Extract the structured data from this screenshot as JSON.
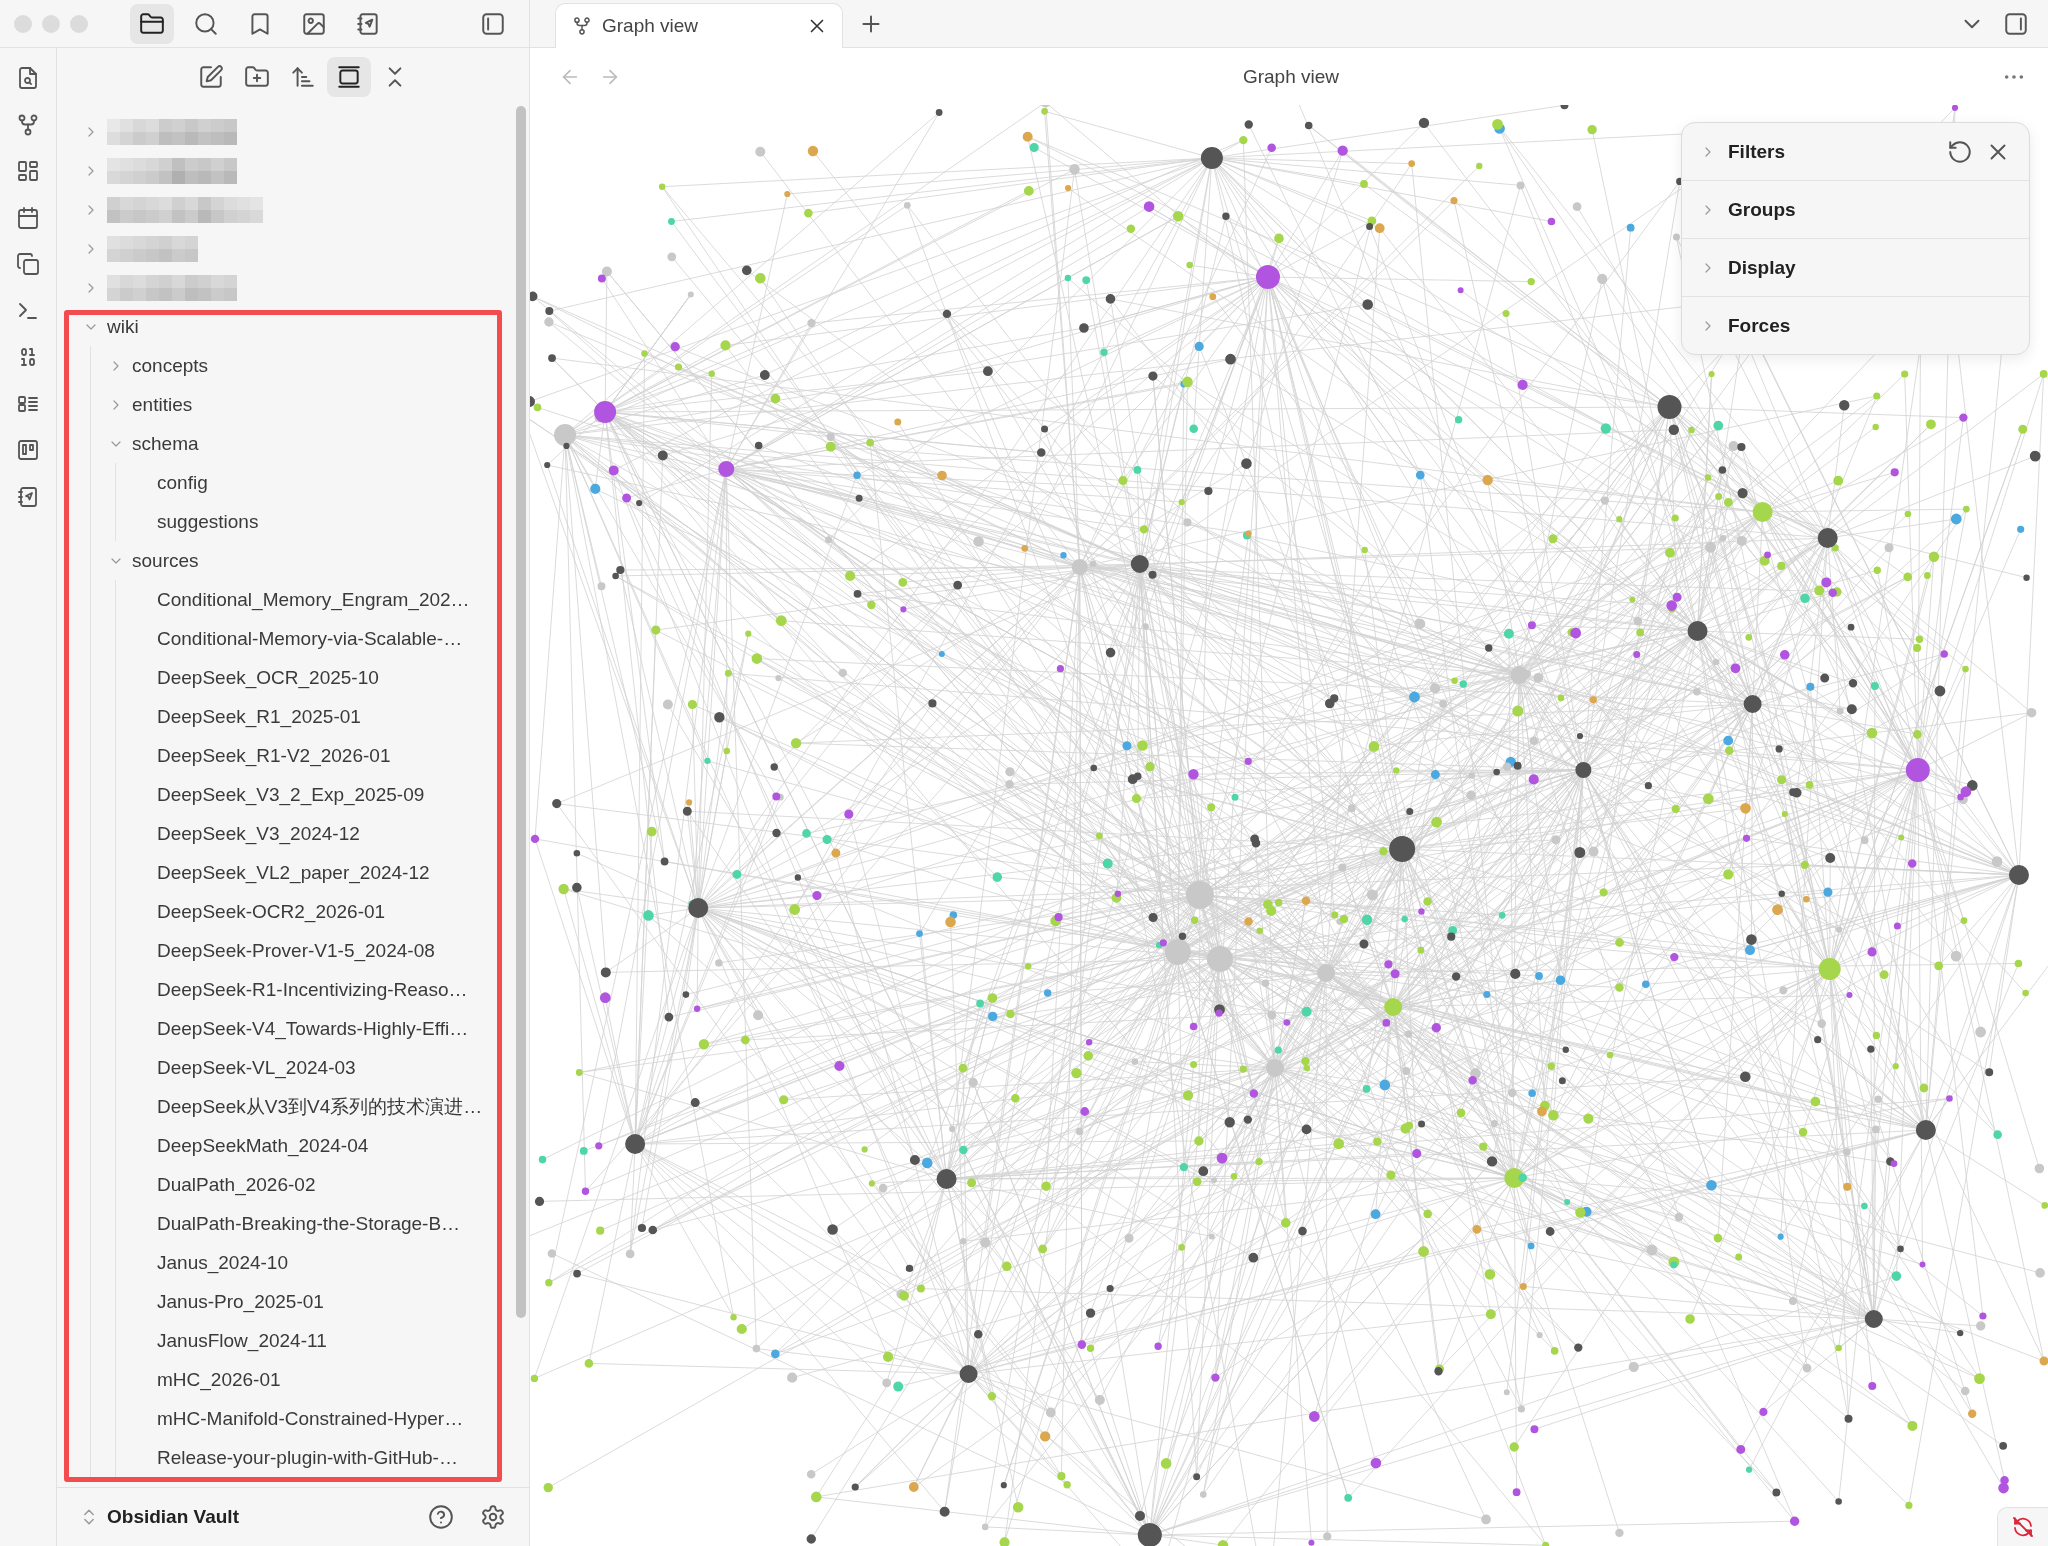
{
  "sidebar_tabs": [
    {
      "selected": true
    },
    {
      "selected": false
    },
    {
      "selected": false
    },
    {
      "selected": false
    },
    {
      "selected": false
    }
  ],
  "nav_buttons": [
    {
      "on": false
    },
    {
      "on": false
    },
    {
      "on": false
    },
    {
      "on": true
    },
    {
      "on": false
    }
  ],
  "tree": [
    {
      "kind": "redacted",
      "expanded": false
    },
    {
      "kind": "redacted",
      "expanded": false
    },
    {
      "kind": "redacted",
      "expanded": false
    },
    {
      "kind": "redacted",
      "expanded": false
    },
    {
      "kind": "redacted",
      "expanded": false
    },
    {
      "kind": "folder",
      "label": "wiki",
      "expanded": true,
      "children": [
        {
          "kind": "folder",
          "label": "concepts",
          "expanded": false
        },
        {
          "kind": "folder",
          "label": "entities",
          "expanded": false
        },
        {
          "kind": "folder",
          "label": "schema",
          "expanded": true,
          "children": [
            {
              "kind": "file",
              "label": "config"
            },
            {
              "kind": "file",
              "label": "suggestions"
            }
          ]
        },
        {
          "kind": "folder",
          "label": "sources",
          "expanded": true,
          "children": [
            {
              "kind": "file",
              "label": "Conditional_Memory_Engram_202…"
            },
            {
              "kind": "file",
              "label": "Conditional-Memory-via-Scalable-…"
            },
            {
              "kind": "file",
              "label": "DeepSeek_OCR_2025-10"
            },
            {
              "kind": "file",
              "label": "DeepSeek_R1_2025-01"
            },
            {
              "kind": "file",
              "label": "DeepSeek_R1-V2_2026-01"
            },
            {
              "kind": "file",
              "label": "DeepSeek_V3_2_Exp_2025-09"
            },
            {
              "kind": "file",
              "label": "DeepSeek_V3_2024-12"
            },
            {
              "kind": "file",
              "label": "DeepSeek_VL2_paper_2024-12"
            },
            {
              "kind": "file",
              "label": "DeepSeek-OCR2_2026-01"
            },
            {
              "kind": "file",
              "label": "DeepSeek-Prover-V1-5_2024-08"
            },
            {
              "kind": "file",
              "label": "DeepSeek-R1-Incentivizing-Reaso…"
            },
            {
              "kind": "file",
              "label": "DeepSeek-V4_Towards-Highly-Effi…"
            },
            {
              "kind": "file",
              "label": "DeepSeek-VL_2024-03"
            },
            {
              "kind": "file",
              "label": "DeepSeek从V3到V4系列的技术演进…"
            },
            {
              "kind": "file",
              "label": "DeepSeekMath_2024-04"
            },
            {
              "kind": "file",
              "label": "DualPath_2026-02"
            },
            {
              "kind": "file",
              "label": "DualPath-Breaking-the-Storage-B…"
            },
            {
              "kind": "file",
              "label": "Janus_2024-10"
            },
            {
              "kind": "file",
              "label": "Janus-Pro_2025-01"
            },
            {
              "kind": "file",
              "label": "JanusFlow_2024-11"
            },
            {
              "kind": "file",
              "label": "mHC_2026-01"
            },
            {
              "kind": "file",
              "label": "mHC-Manifold-Constrained-Hyper…"
            },
            {
              "kind": "file",
              "label": "Release-your-plugin-with-GitHub-…"
            }
          ]
        }
      ]
    }
  ],
  "vault": {
    "name": "Obsidian Vault"
  },
  "tabs": [
    {
      "title": "Graph view",
      "selected": true
    }
  ],
  "view": {
    "title": "Graph view"
  },
  "graph_controls": {
    "sections": [
      {
        "label": "Filters",
        "expanded": false
      },
      {
        "label": "Groups",
        "expanded": false
      },
      {
        "label": "Display",
        "expanded": false
      },
      {
        "label": "Forces",
        "expanded": false
      }
    ]
  },
  "sync": {
    "error": true
  }
}
